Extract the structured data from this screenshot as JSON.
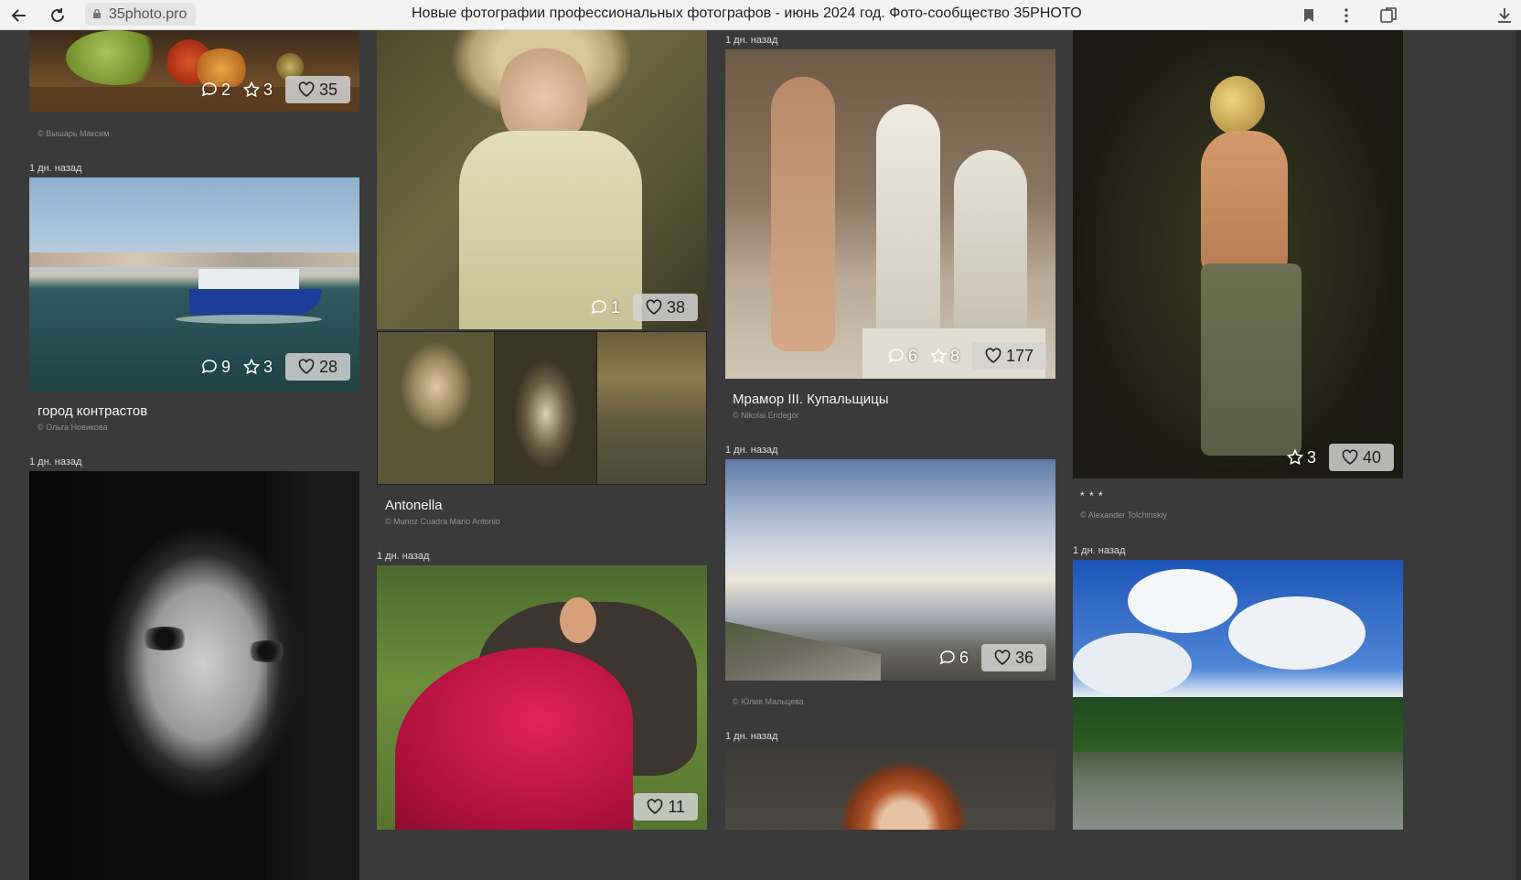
{
  "browser": {
    "url": "35photo.pro",
    "title": "Новые фотографии профессиональных фотографов - июнь 2024 год. Фото-сообщество 35PHOTO"
  },
  "colors": {
    "page_bg": "#3a3a3a",
    "like_badge": "#d2d2d2"
  },
  "cards": {
    "fruit": {
      "comments": "2",
      "favorites": "3",
      "likes": "35",
      "author": "© Вышарь Максим"
    },
    "boat": {
      "time": "1 дн. назад",
      "comments": "9",
      "favorites": "3",
      "likes": "28",
      "caption": "город контрастов",
      "author": "© Ольга Новикова"
    },
    "bw_portrait": {
      "time": "1 дн. назад"
    },
    "antonella": {
      "comments": "1",
      "likes": "38",
      "caption": "Antonella",
      "author": "© Munoz Cuadra Mario Antonio"
    },
    "red_dress": {
      "time": "1 дн. назад",
      "likes": "11"
    },
    "marble": {
      "time": "1 дн. назад",
      "comments": "6",
      "favorites": "8",
      "likes": "177",
      "caption": "Мрамор III. Купальщицы",
      "author": "© Nikolai Endegor"
    },
    "clouds": {
      "time": "1 дн. назад",
      "comments": "6",
      "likes": "36",
      "author": "© Юлия Мальцева"
    },
    "redhead": {
      "time": "1 дн. назад"
    },
    "model": {
      "favorites": "3",
      "likes": "40",
      "caption": "* * *",
      "author": "© Alexander Tolchinskiy"
    },
    "lake": {
      "time": "1 дн. назад"
    }
  }
}
